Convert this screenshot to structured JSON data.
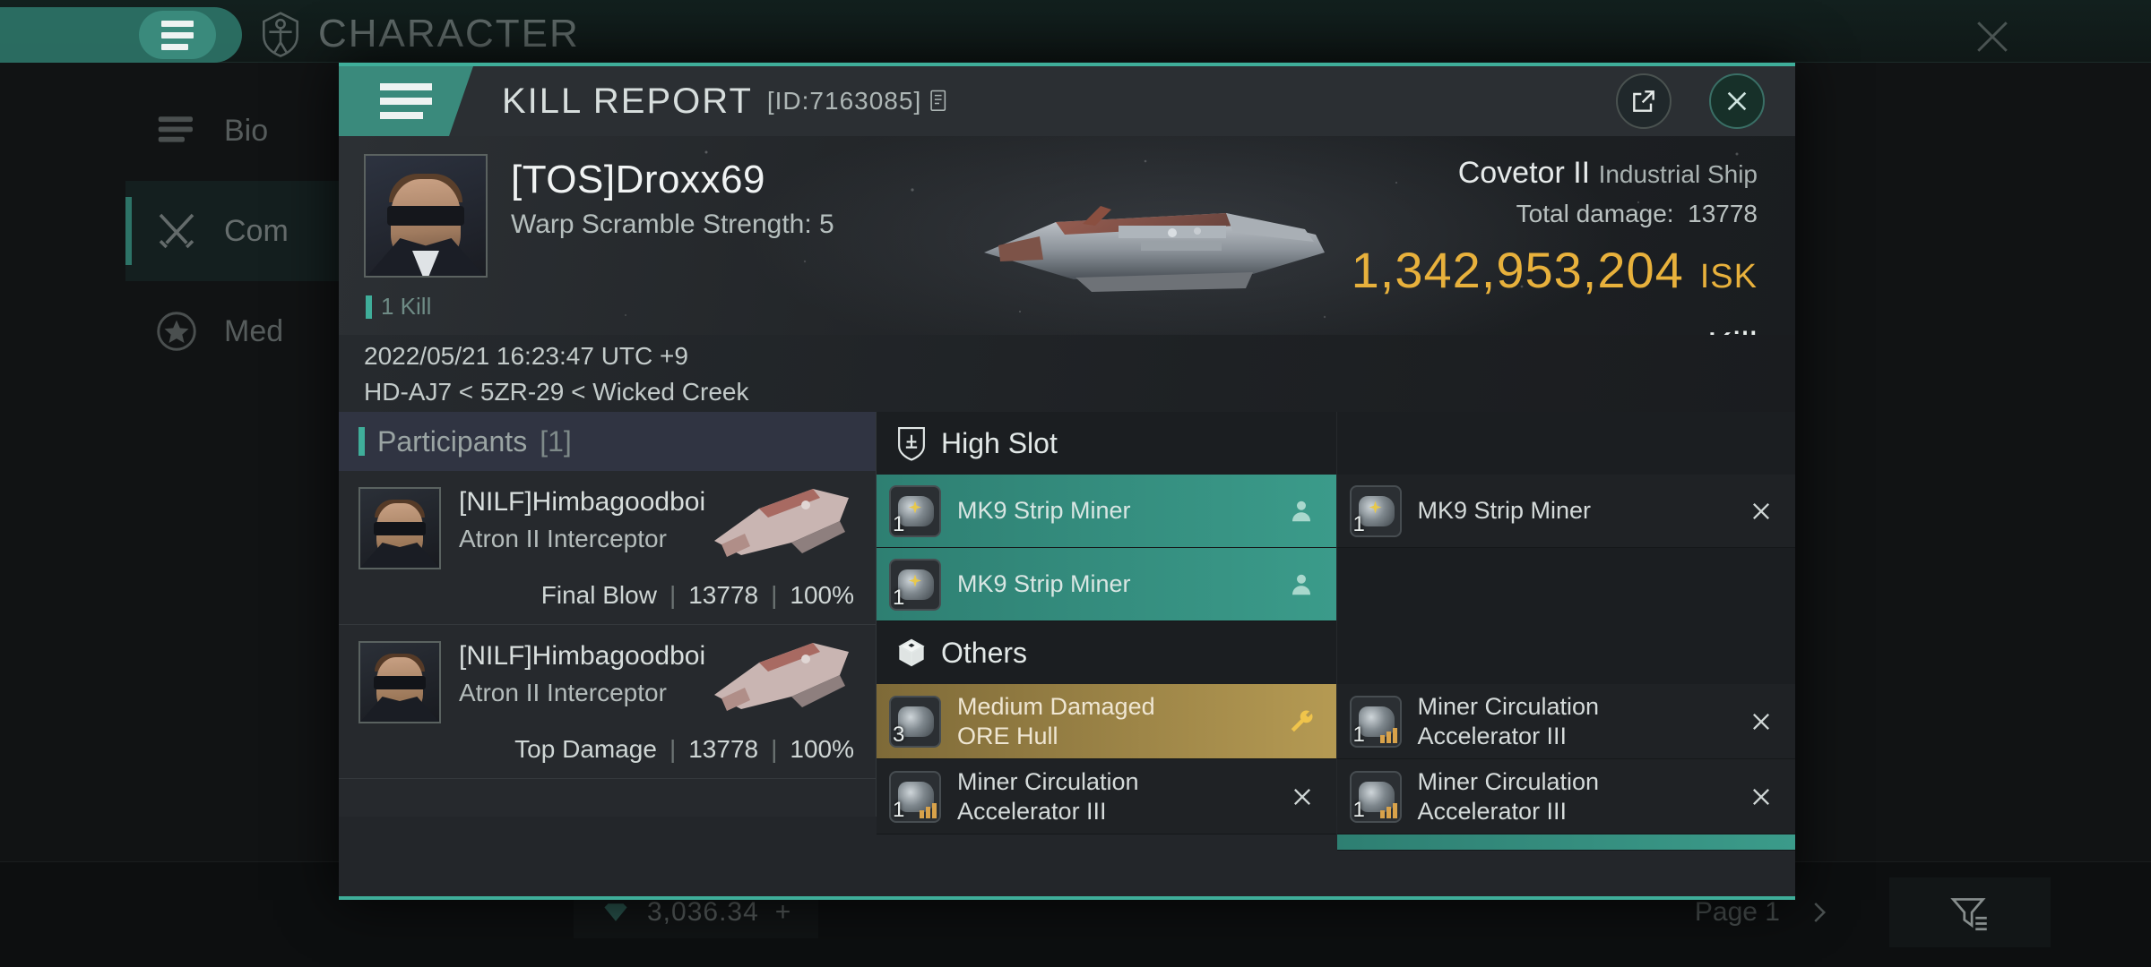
{
  "background": {
    "header": {
      "title": "CHARACTER",
      "icon": "vitruvian-man-icon",
      "menu_icon": "hamburger-icon",
      "close_icon": "close-icon"
    },
    "sidebar": [
      {
        "label": "Bio",
        "icon": "list-icon",
        "selected": false
      },
      {
        "label": "Com",
        "icon": "crossed-swords-icon",
        "selected": true
      },
      {
        "label": "Med",
        "icon": "star-medal-icon",
        "selected": false
      }
    ],
    "bottom": {
      "isk_value": "3,036.34",
      "isk_icon": "isk-icon",
      "increment_label": "+",
      "page_label": "Page 1",
      "next_icon": "chevron-right-icon",
      "filter_icon": "filter-icon"
    }
  },
  "modal": {
    "header": {
      "menu_icon": "hamburger-icon",
      "title": "KILL REPORT",
      "id_label": "[ID:7163085]",
      "copy_icon": "copy-icon",
      "share_icon": "external-link-icon",
      "close_icon": "close-icon"
    },
    "victim": {
      "name": "[TOS]Droxx69",
      "scramble": "Warp Scramble Strength: 5",
      "kill_tag": "1 Kill",
      "timestamp": "2022/05/21 16:23:47 UTC +9",
      "location": "HD-AJ7 < 5ZR-29 < Wicked Creek",
      "avatar": "player-portrait"
    },
    "ship": {
      "name": "Covetor II",
      "class": "Industrial Ship",
      "total_damage_label": "Total damage:",
      "total_damage_value": "13778",
      "isk_value": "1,342,953,204",
      "isk_unit": "ISK",
      "result": "Kill"
    },
    "participants": {
      "section_label": "Participants",
      "count_label": "[1]",
      "rows": [
        {
          "name": "[NILF]Himbagoodboi",
          "ship": "Atron II Interceptor",
          "tag": "Final Blow",
          "damage": "13778",
          "percent": "100%"
        },
        {
          "name": "[NILF]Himbagoodboi",
          "ship": "Atron II Interceptor",
          "tag": "Top Damage",
          "damage": "13778",
          "percent": "100%"
        }
      ]
    },
    "fitting": {
      "sections": [
        {
          "title": "High Slot",
          "icon": "high-slot-icon"
        },
        {
          "title": "Others",
          "icon": "cube-icon"
        }
      ],
      "left_column": [
        {
          "name": "MK9 Strip Miner",
          "qty": "1",
          "state": "dropped",
          "state_icon": "person-icon",
          "style": "teal",
          "section": "High Slot"
        },
        {
          "name": "MK9 Strip Miner",
          "qty": "1",
          "state": "dropped",
          "state_icon": "person-icon",
          "style": "teal",
          "section": "High Slot"
        },
        {
          "name": "Medium Damaged\nORE Hull",
          "name_line1": "Medium Damaged",
          "name_line2": "ORE Hull",
          "qty": "3",
          "state": "salvaged",
          "state_icon": "wrench-icon",
          "style": "gold",
          "section": "Others"
        },
        {
          "name_line1": "Miner Circulation",
          "name_line2": "Accelerator III",
          "qty": "1",
          "state": "destroyed",
          "state_icon": "x-icon",
          "style": "dark",
          "section": "Others"
        }
      ],
      "right_column": [
        {
          "name": "MK9 Strip Miner",
          "qty": "1",
          "state": "destroyed",
          "state_icon": "x-icon",
          "style": "dark",
          "section": "High Slot"
        },
        {
          "name_line1": "Miner Circulation",
          "name_line2": "Accelerator III",
          "qty": "1",
          "state": "destroyed",
          "state_icon": "x-icon",
          "style": "dark",
          "section": "Others"
        },
        {
          "name_line1": "Miner Circulation",
          "name_line2": "Accelerator III",
          "qty": "1",
          "state": "destroyed",
          "state_icon": "x-icon",
          "style": "dark",
          "section": "Others"
        }
      ]
    }
  },
  "colors": {
    "accent_teal": "#3fae9a",
    "isk_gold": "#e8b13c",
    "module_gold": "#b59a53",
    "panel_dark": "#1b1e21"
  }
}
